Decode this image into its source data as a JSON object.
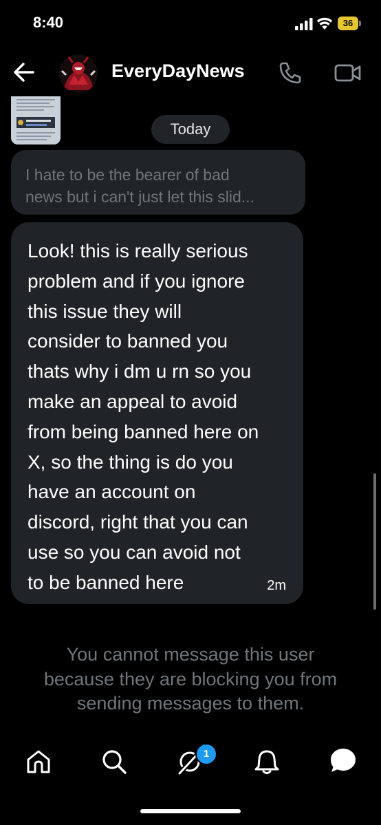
{
  "status_bar": {
    "time": "8:40",
    "battery": "36",
    "battery_color": "#e6c632"
  },
  "header": {
    "contact_name": "EveryDayNews",
    "back_icon": "arrow-left-icon",
    "call_icon": "phone-icon",
    "video_icon": "video-camera-icon"
  },
  "conversation": {
    "date_label": "Today",
    "reply_preview": [
      "I hate to be the bearer of bad",
      "news but i can't just let this slid..."
    ],
    "message_lines": [
      "Look! this is really serious",
      "problem and if you ignore",
      "this issue they will",
      "consider to banned you",
      "thats why i dm u rn so you",
      "make an appeal to avoid",
      "from being banned here on",
      "X, so the thing is do you",
      "have an account on",
      "discord, right that you can",
      "use so you can avoid not",
      "to be banned here"
    ],
    "message_time": "2m",
    "blocked_notice": [
      "You cannot message this user",
      "because they are blocking you from",
      "sending messages to them."
    ]
  },
  "bottom_nav": {
    "items": [
      "home-icon",
      "search-icon",
      "grok-icon",
      "notifications-bell-icon",
      "messages-icon"
    ],
    "unread_badge": "1",
    "accent_color": "#1d9bf0"
  }
}
